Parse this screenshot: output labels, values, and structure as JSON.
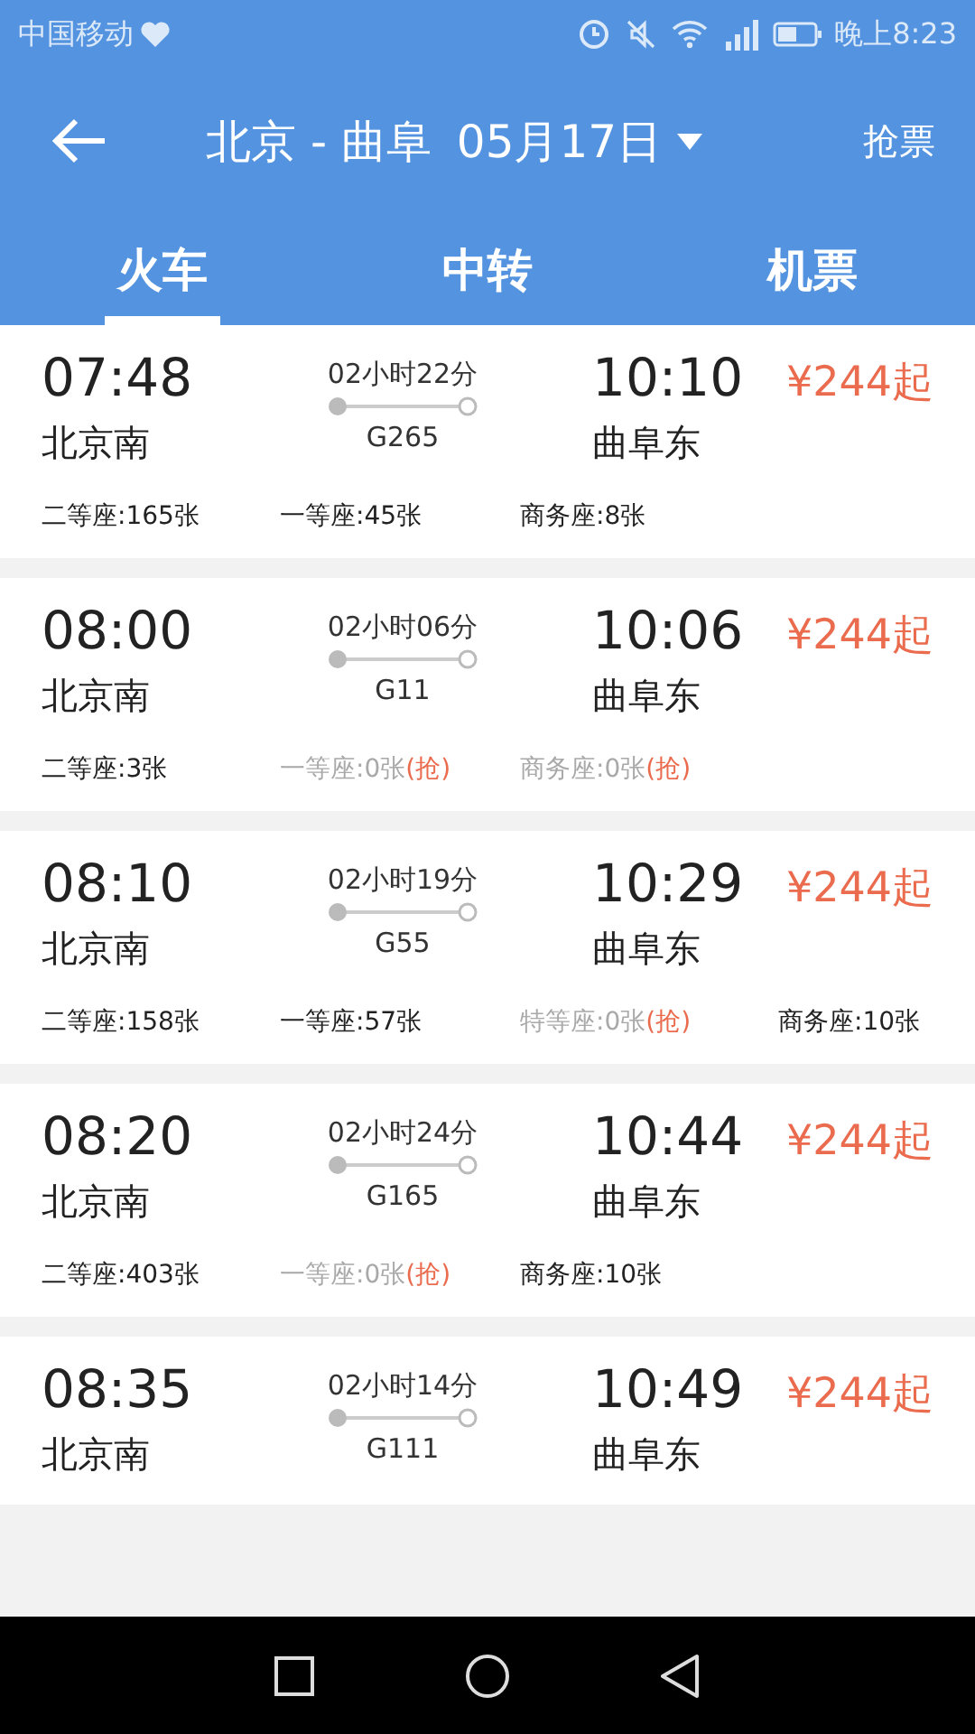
{
  "status_bar": {
    "carrier": "中国移动",
    "time": "晚上8:23"
  },
  "header": {
    "route": "北京 - 曲阜",
    "date": "05月17日",
    "action": "抢票"
  },
  "tabs": [
    {
      "label": "火车",
      "selected": true
    },
    {
      "label": "中转",
      "selected": false
    },
    {
      "label": "机票",
      "selected": false
    }
  ],
  "trains": [
    {
      "depart_time": "07:48",
      "depart_station": "北京南",
      "duration": "02小时22分",
      "number": "G265",
      "arrive_time": "10:10",
      "arrive_station": "曲阜东",
      "price": "¥244起",
      "seats": [
        {
          "text": "二等座:165张",
          "available": true
        },
        {
          "text": "一等座:45张",
          "available": true
        },
        {
          "text": "商务座:8张",
          "available": true
        }
      ]
    },
    {
      "depart_time": "08:00",
      "depart_station": "北京南",
      "duration": "02小时06分",
      "number": "G11",
      "arrive_time": "10:06",
      "arrive_station": "曲阜东",
      "price": "¥244起",
      "seats": [
        {
          "text": "二等座:3张",
          "available": true
        },
        {
          "text": "一等座:0张",
          "available": false,
          "grab": "(抢)"
        },
        {
          "text": "商务座:0张",
          "available": false,
          "grab": "(抢)"
        }
      ]
    },
    {
      "depart_time": "08:10",
      "depart_station": "北京南",
      "duration": "02小时19分",
      "number": "G55",
      "arrive_time": "10:29",
      "arrive_station": "曲阜东",
      "price": "¥244起",
      "seats": [
        {
          "text": "二等座:158张",
          "available": true
        },
        {
          "text": "一等座:57张",
          "available": true
        },
        {
          "text": "特等座:0张",
          "available": false,
          "grab": "(抢)"
        },
        {
          "text": "商务座:10张",
          "available": true
        }
      ]
    },
    {
      "depart_time": "08:20",
      "depart_station": "北京南",
      "duration": "02小时24分",
      "number": "G165",
      "arrive_time": "10:44",
      "arrive_station": "曲阜东",
      "price": "¥244起",
      "seats": [
        {
          "text": "二等座:403张",
          "available": true
        },
        {
          "text": "一等座:0张",
          "available": false,
          "grab": "(抢)"
        },
        {
          "text": "商务座:10张",
          "available": true
        }
      ]
    },
    {
      "depart_time": "08:35",
      "depart_station": "北京南",
      "duration": "02小时14分",
      "number": "G111",
      "arrive_time": "10:49",
      "arrive_station": "曲阜东",
      "price": "¥244起"
    }
  ]
}
